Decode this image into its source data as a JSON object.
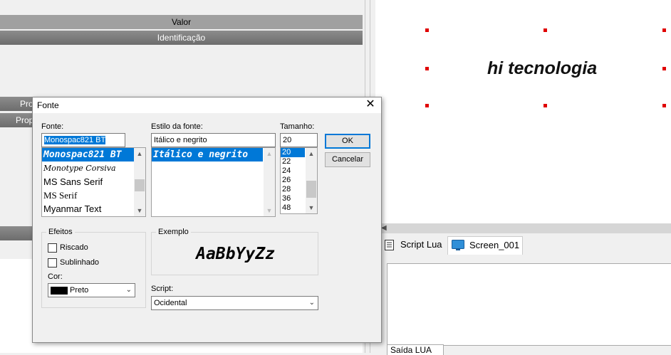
{
  "left_panel": {
    "header_valor": "Valor",
    "header_identificacao": "Identificação",
    "row_prop1": "Pro",
    "row_prop2": "Prop"
  },
  "canvas": {
    "text": "hi tecnologia"
  },
  "tabs": [
    {
      "label": "Script Lua",
      "icon": "script-icon"
    },
    {
      "label": "Screen_001",
      "icon": "monitor-icon"
    }
  ],
  "output_tab": "Saída LUA",
  "dialog": {
    "title": "Fonte",
    "close": "✕",
    "font": {
      "label": "Fonte:",
      "value": "Monospac821 BT",
      "items": [
        "Monospac821 BT",
        "Monotype Corsiva",
        "MS Sans Serif",
        "MS Serif",
        "Myanmar Text"
      ],
      "selected_index": 0
    },
    "style": {
      "label": "Estilo da fonte:",
      "value": "Itálico e negrito",
      "items": [
        "Itálico e negrito"
      ],
      "selected_index": 0
    },
    "size": {
      "label": "Tamanho:",
      "value": "20",
      "items": [
        "20",
        "22",
        "24",
        "26",
        "28",
        "36",
        "48"
      ],
      "selected_index": 0
    },
    "ok_label": "OK",
    "cancel_label": "Cancelar",
    "effects": {
      "title": "Efeitos",
      "strikeout": "Riscado",
      "underline": "Sublinhado",
      "color_label": "Cor:",
      "color_value": "Preto",
      "color_swatch": "#000000"
    },
    "sample": {
      "title": "Exemplo",
      "text": "AaBbYyZz"
    },
    "script": {
      "label": "Script:",
      "value": "Ocidental"
    }
  },
  "colors": {
    "selection": "#0078d7",
    "handle": "#e00000",
    "header_dark": "#6d6d6d"
  }
}
